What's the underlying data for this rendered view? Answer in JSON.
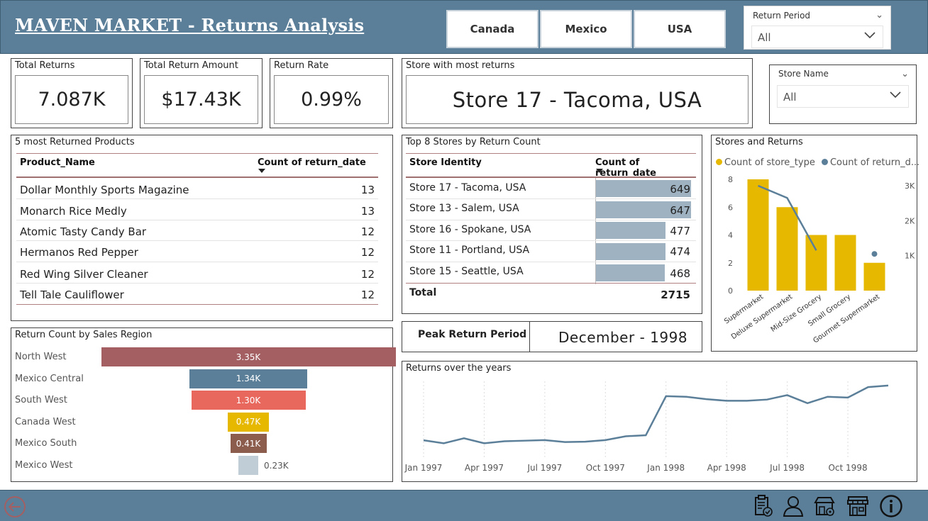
{
  "header": {
    "title": "MAVEN MARKET - Returns Analysis",
    "countries": [
      "Canada",
      "Mexico",
      "USA"
    ],
    "return_period": {
      "title": "Return Period",
      "value": "All"
    }
  },
  "kpis": [
    {
      "title": "Total Returns",
      "value": "7.087K"
    },
    {
      "title": "Total Return Amount",
      "value": "$17.43K"
    },
    {
      "title": "Return Rate",
      "value": "0.99%"
    }
  ],
  "store_most_returns": {
    "title": "Store with most returns",
    "value": "Store 17 - Tacoma, USA"
  },
  "store_name_slicer": {
    "title": "Store Name",
    "value": "All"
  },
  "top_products": {
    "title": "5 most Returned Products",
    "columns": [
      "Product_Name",
      "Count of return_date"
    ],
    "rows": [
      {
        "name": "Dollar Monthly Sports Magazine",
        "count": "13"
      },
      {
        "name": "Monarch Rice Medly",
        "count": "13"
      },
      {
        "name": "Atomic Tasty Candy Bar",
        "count": "12"
      },
      {
        "name": "Hermanos Red Pepper",
        "count": "12"
      },
      {
        "name": "Red Wing Silver Cleaner",
        "count": "12"
      },
      {
        "name": "Tell Tale Cauliflower",
        "count": "12"
      }
    ]
  },
  "top_stores": {
    "title": "Top 8 Stores by Return Count",
    "columns": [
      "Store Identity",
      "Count of return_date"
    ],
    "rows": [
      {
        "name": "Store 17 - Tacoma, USA",
        "count": "649",
        "value": 649
      },
      {
        "name": "Store 13 - Salem, USA",
        "count": "647",
        "value": 647
      },
      {
        "name": "Store 16 - Spokane, USA",
        "count": "477",
        "value": 477
      },
      {
        "name": "Store 11 - Portland, USA",
        "count": "474",
        "value": 474
      },
      {
        "name": "Store 15 - Seattle, USA",
        "count": "468",
        "value": 468
      }
    ],
    "total_label": "Total",
    "total_value": "2715"
  },
  "stores_returns": {
    "title": "Stores and Returns",
    "legend": [
      "Count of store_type",
      "Count of return_d..."
    ],
    "colors": {
      "bar": "#e6b800",
      "line": "#5b7f99"
    }
  },
  "region_chart": {
    "title": "Return Count by Sales Region"
  },
  "peak": {
    "label": "Peak Return Period",
    "value": "December - 1998"
  },
  "years_chart": {
    "title": "Returns over the years"
  },
  "chart_data": [
    {
      "type": "bar",
      "title": "Stores and Returns",
      "categories": [
        "Supermarket",
        "Deluxe Supermarket",
        "Mid-Size Grocery",
        "Small Grocery",
        "Gourmet Supermarket"
      ],
      "series": [
        {
          "name": "Count of store_type",
          "kind": "bar",
          "axis": "left",
          "values": [
            8,
            6,
            4,
            4,
            2
          ]
        },
        {
          "name": "Count of return_d...",
          "kind": "line",
          "axis": "right",
          "values": [
            3000,
            2650,
            1150,
            null,
            1050
          ]
        }
      ],
      "ylim_left": [
        0,
        8
      ],
      "yticks_left": [
        "0",
        "2",
        "4",
        "6",
        "8"
      ],
      "ylim_right": [
        0,
        3000
      ],
      "yticks_right": [
        "1K",
        "2K",
        "3K"
      ],
      "legend": "top"
    },
    {
      "type": "bar",
      "title": "Return Count by Sales Region",
      "categories": [
        "North West",
        "Mexico Central",
        "South West",
        "Canada West",
        "Mexico South",
        "Mexico West"
      ],
      "values": [
        3350,
        1340,
        1300,
        470,
        410,
        230
      ],
      "labels": [
        "3.35K",
        "1.34K",
        "1.30K",
        "0.47K",
        "0.41K",
        "0.23K"
      ],
      "colors": [
        "#a35f62",
        "#5b7f99",
        "#e8685e",
        "#e6b800",
        "#8c5c4d",
        "#c0cdd6"
      ]
    },
    {
      "type": "line",
      "title": "Returns over the years",
      "x": [
        "Jan 1997",
        "Feb 1997",
        "Mar 1997",
        "Apr 1997",
        "May 1997",
        "Jun 1997",
        "Jul 1997",
        "Aug 1997",
        "Sep 1997",
        "Oct 1997",
        "Nov 1997",
        "Dec 1997",
        "Jan 1998",
        "Feb 1998",
        "Mar 1998",
        "Apr 1998",
        "May 1998",
        "Jun 1998",
        "Jul 1998",
        "Aug 1998",
        "Sep 1998",
        "Oct 1998",
        "Nov 1998",
        "Dec 1998"
      ],
      "x_ticks": [
        "Jan 1997",
        "Apr 1997",
        "Jul 1997",
        "Oct 1997",
        "Jan 1998",
        "Apr 1998",
        "Jul 1998",
        "Oct 1998"
      ],
      "values": [
        155,
        140,
        165,
        140,
        150,
        153,
        156,
        146,
        148,
        156,
        175,
        180,
        375,
        372,
        360,
        352,
        352,
        358,
        380,
        340,
        372,
        368,
        420,
        428
      ],
      "ylim": [
        60,
        470
      ],
      "grid": true
    }
  ],
  "footer": {
    "icons": [
      "clipboard-check-icon",
      "user-icon",
      "store-settings-icon",
      "storefront-icon",
      "info-icon"
    ]
  }
}
